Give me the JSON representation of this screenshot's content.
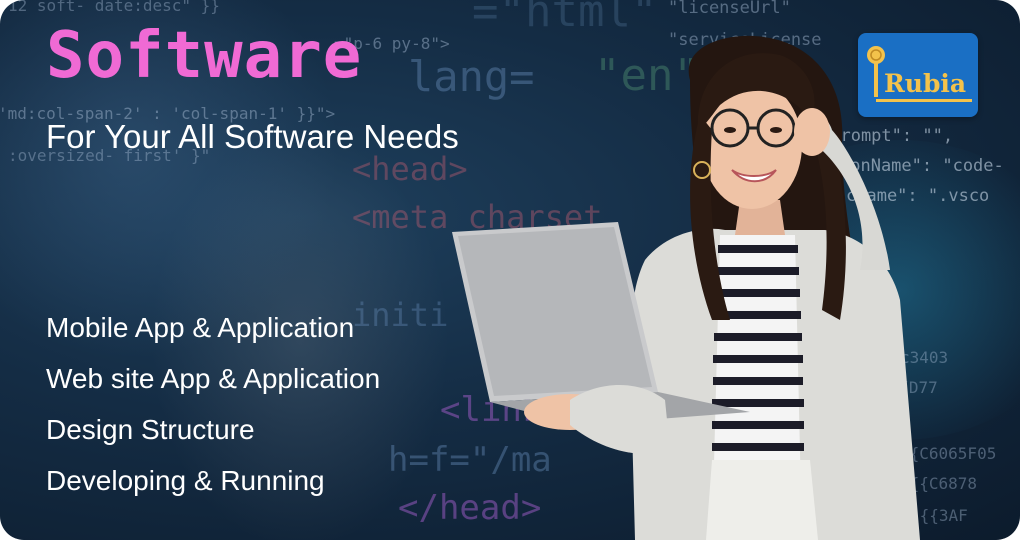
{
  "banner": {
    "title": "Software",
    "subtitle": "For Your All Software Needs",
    "services": [
      "Mobile App & Application",
      "Web site App & Application",
      "Design Structure",
      "Developing & Running"
    ]
  },
  "logo": {
    "text": "Rubia",
    "icon": "microphone-icon"
  },
  "code_background": {
    "lines": [
      "12  soft- date:desc\" }}",
      "=\"html\"",
      "\"licenseUrl\"",
      "=\"p-6 py-8\">",
      "\"serviceLicense",
      "lang=",
      "\"en\"",
      "'md:col-span-2' : 'col-span-1' }}\">",
      ":oversized- first' }\"",
      "\"prompt\": \"\",",
      "<head>",
      "ionName\": \"code-",
      "<meta charset",
      "cName\": \".vsco",
      "initi",
      "c3403",
      "\"{{D77",
      "<link",
      "{{C6065F05",
      "h=f=\"/ma",
      "\"{{C6878",
      "</head>",
      "\"{{3AF"
    ]
  },
  "colors": {
    "title": "#f06ad4",
    "text": "#ffffff",
    "logo_bg": "#1a6fc4",
    "logo_text": "#f3c24b",
    "background": "#142c44"
  }
}
